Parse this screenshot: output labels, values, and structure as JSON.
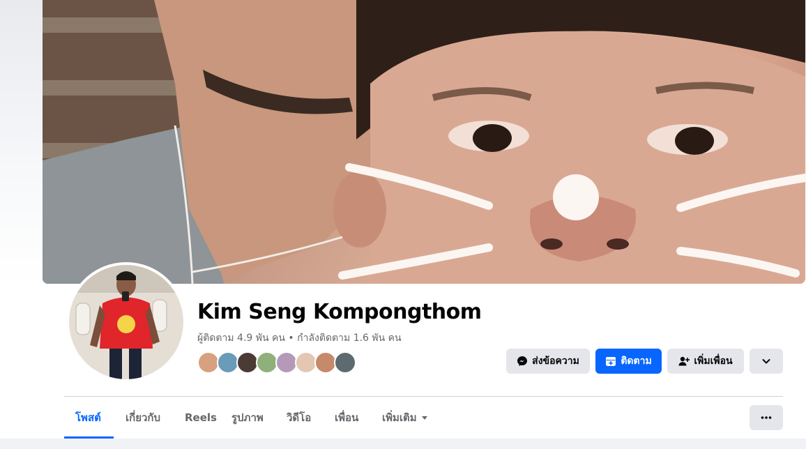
{
  "profile": {
    "name": "Kim Seng Kompongthom",
    "followers_label": "ผู้ติดตาม",
    "followers_count": "4.9 พัน",
    "followers_unit": "คน",
    "separator": "•",
    "following_label": "กำลังติดตาม",
    "following_count": "1.6 พัน",
    "following_unit": "คน"
  },
  "actions": {
    "message_label": "ส่งข้อความ",
    "follow_label": "ติดตาม",
    "add_friend_label": "เพิ่มเพื่อน",
    "more_icon": "chevron-down-icon"
  },
  "tabs": [
    {
      "label": "โพสต์",
      "active": true
    },
    {
      "label": "เกี่ยวกับ",
      "active": false
    },
    {
      "label": "Reels",
      "active": false
    },
    {
      "label": "รูปภาพ",
      "active": false
    },
    {
      "label": "วิดีโอ",
      "active": false
    },
    {
      "label": "เพื่อน",
      "active": false
    },
    {
      "label": "เพิ่มเติม",
      "active": false
    }
  ],
  "tab_more_icon": "caret-down-icon",
  "overflow_icon": "ellipsis-icon",
  "colors": {
    "accent": "#0866ff",
    "secondary_text": "#65676b",
    "button_grey": "#e4e6eb",
    "primary_text": "#050505"
  }
}
